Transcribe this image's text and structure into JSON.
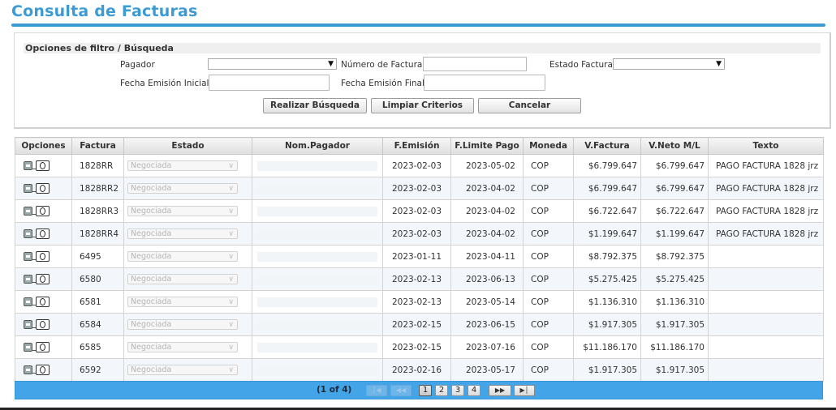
{
  "page": {
    "title": "Consulta de Facturas"
  },
  "filters": {
    "header": "Opciones de filtro / Búsqueda",
    "pagador_label": "Pagador",
    "pagador_value": "",
    "numero_label": "Número de Factura",
    "numero_value": "",
    "estado_label": "Estado Factura",
    "estado_value": "",
    "fecha_inicial_label": "Fecha Emisión Inicial",
    "fecha_inicial_value": "",
    "fecha_final_label": "Fecha Emisión Final",
    "fecha_final_value": "",
    "buttons": {
      "search": "Realizar Búsqueda",
      "clear": "Limpiar Criterios",
      "cancel": "Cancelar"
    }
  },
  "table": {
    "columns": [
      "Opciones",
      "Factura",
      "Estado",
      "Nom.Pagador",
      "F.Emisión",
      "F.Limite Pago",
      "Moneda",
      "V.Factura",
      "V.Neto M/L",
      "Texto"
    ],
    "rows": [
      {
        "factura": "1828RR",
        "estado": "Negociada",
        "pagador": "",
        "emision": "2023-02-03",
        "limite": "2023-05-02",
        "moneda": "COP",
        "vfactura": "$6.799.647",
        "vneto": "$6.799.647",
        "texto": "PAGO FACTURA 1828 jrz"
      },
      {
        "factura": "1828RR2",
        "estado": "Negociada",
        "pagador": "",
        "emision": "2023-02-03",
        "limite": "2023-04-02",
        "moneda": "COP",
        "vfactura": "$6.799.647",
        "vneto": "$6.799.647",
        "texto": "PAGO FACTURA 1828 jrz"
      },
      {
        "factura": "1828RR3",
        "estado": "Negociada",
        "pagador": "",
        "emision": "2023-02-03",
        "limite": "2023-04-02",
        "moneda": "COP",
        "vfactura": "$6.722.647",
        "vneto": "$6.722.647",
        "texto": "PAGO FACTURA 1828 jrz"
      },
      {
        "factura": "1828RR4",
        "estado": "Negociada",
        "pagador": "",
        "emision": "2023-02-03",
        "limite": "2023-04-02",
        "moneda": "COP",
        "vfactura": "$1.199.647",
        "vneto": "$1.199.647",
        "texto": "PAGO FACTURA 1828 jrz"
      },
      {
        "factura": "6495",
        "estado": "Negociada",
        "pagador": "",
        "emision": "2023-01-11",
        "limite": "2023-04-11",
        "moneda": "COP",
        "vfactura": "$8.792.375",
        "vneto": "$8.792.375",
        "texto": ""
      },
      {
        "factura": "6580",
        "estado": "Negociada",
        "pagador": "",
        "emision": "2023-02-13",
        "limite": "2023-06-13",
        "moneda": "COP",
        "vfactura": "$5.275.425",
        "vneto": "$5.275.425",
        "texto": ""
      },
      {
        "factura": "6581",
        "estado": "Negociada",
        "pagador": "",
        "emision": "2023-02-13",
        "limite": "2023-05-14",
        "moneda": "COP",
        "vfactura": "$1.136.310",
        "vneto": "$1.136.310",
        "texto": ""
      },
      {
        "factura": "6584",
        "estado": "Negociada",
        "pagador": "",
        "emision": "2023-02-15",
        "limite": "2023-06-15",
        "moneda": "COP",
        "vfactura": "$1.917.305",
        "vneto": "$1.917.305",
        "texto": ""
      },
      {
        "factura": "6585",
        "estado": "Negociada",
        "pagador": "",
        "emision": "2023-02-15",
        "limite": "2023-07-16",
        "moneda": "COP",
        "vfactura": "$11.186.170",
        "vneto": "$11.186.170",
        "texto": ""
      },
      {
        "factura": "6592",
        "estado": "Negociada",
        "pagador": "",
        "emision": "2023-02-16",
        "limite": "2023-05-17",
        "moneda": "COP",
        "vfactura": "$1.917.305",
        "vneto": "$1.917.305",
        "texto": ""
      }
    ]
  },
  "paginator": {
    "summary": "(1 of 4)",
    "first_icon": "first-page-icon",
    "prev_icon": "previous-page-icon",
    "next_icon": "next-page-icon",
    "last_icon": "last-page-icon",
    "pages": [
      "1",
      "2",
      "3",
      "4"
    ],
    "current_page": "1"
  },
  "colors": {
    "accent": "#3d9bd4",
    "paginator": "#43a4e8"
  }
}
